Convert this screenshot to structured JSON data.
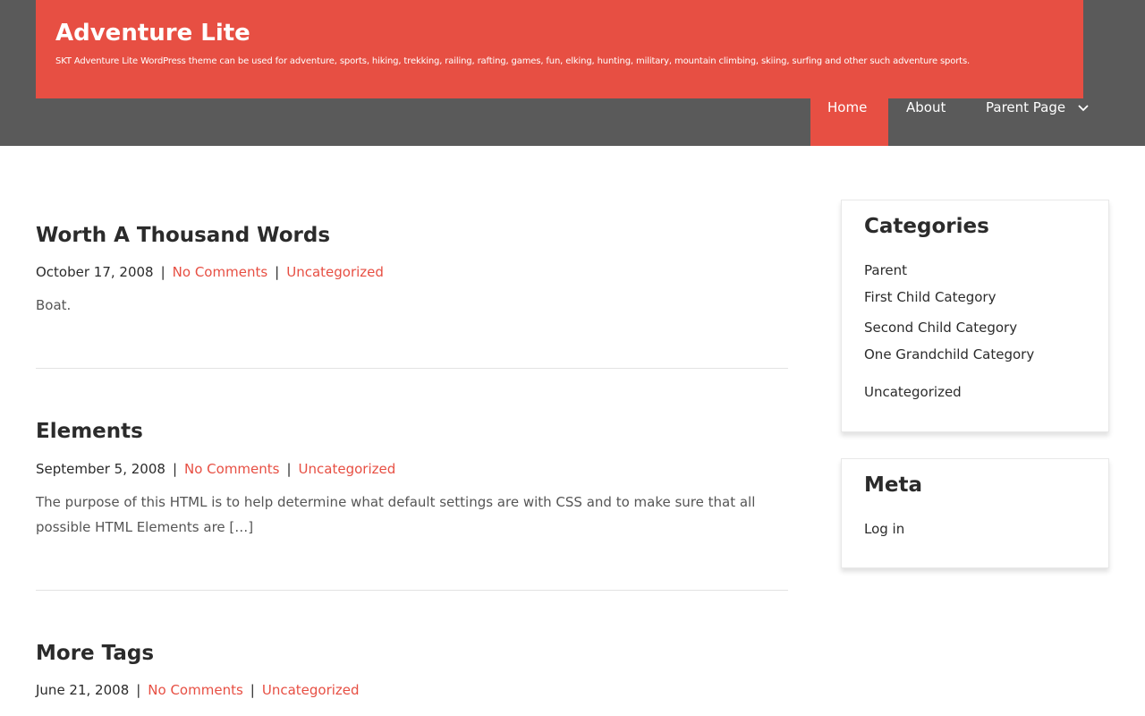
{
  "site": {
    "title": "Adventure Lite",
    "description": "SKT Adventure Lite WordPress theme can be used for adventure, sports, hiking, trekking, railing, rafting, games, fun, elking, hunting, military, mountain climbing, skiing, surfing and other such adventure sports."
  },
  "nav": {
    "home": "Home",
    "about": "About",
    "parent_page": "Parent Page"
  },
  "posts": [
    {
      "title": "Worth A Thousand Words",
      "date": "October 17, 2008",
      "comments": "No Comments",
      "category": "Uncategorized",
      "excerpt": "Boat."
    },
    {
      "title": "Elements",
      "date": "September 5, 2008",
      "comments": "No Comments",
      "category": "Uncategorized",
      "excerpt": "The purpose of this HTML is to help determine what default settings are with CSS and to make sure that all possible HTML Elements are […]"
    },
    {
      "title": "More Tags",
      "date": "June 21, 2008",
      "comments": "No Comments",
      "category": "Uncategorized"
    }
  ],
  "meta_separator": "|",
  "sidebar": {
    "categories": {
      "title": "Categories",
      "items": [
        "Parent",
        "First Child Category",
        "Second Child Category",
        "One Grandchild Category",
        "Uncategorized"
      ]
    },
    "meta": {
      "title": "Meta",
      "items": [
        "Log in"
      ]
    }
  },
  "colors": {
    "accent": "#e74f43",
    "header_bg": "#5a5a5a",
    "text": "#2b2b2b"
  },
  "icons": {
    "nav_dropdown": "chevron-down-icon"
  }
}
